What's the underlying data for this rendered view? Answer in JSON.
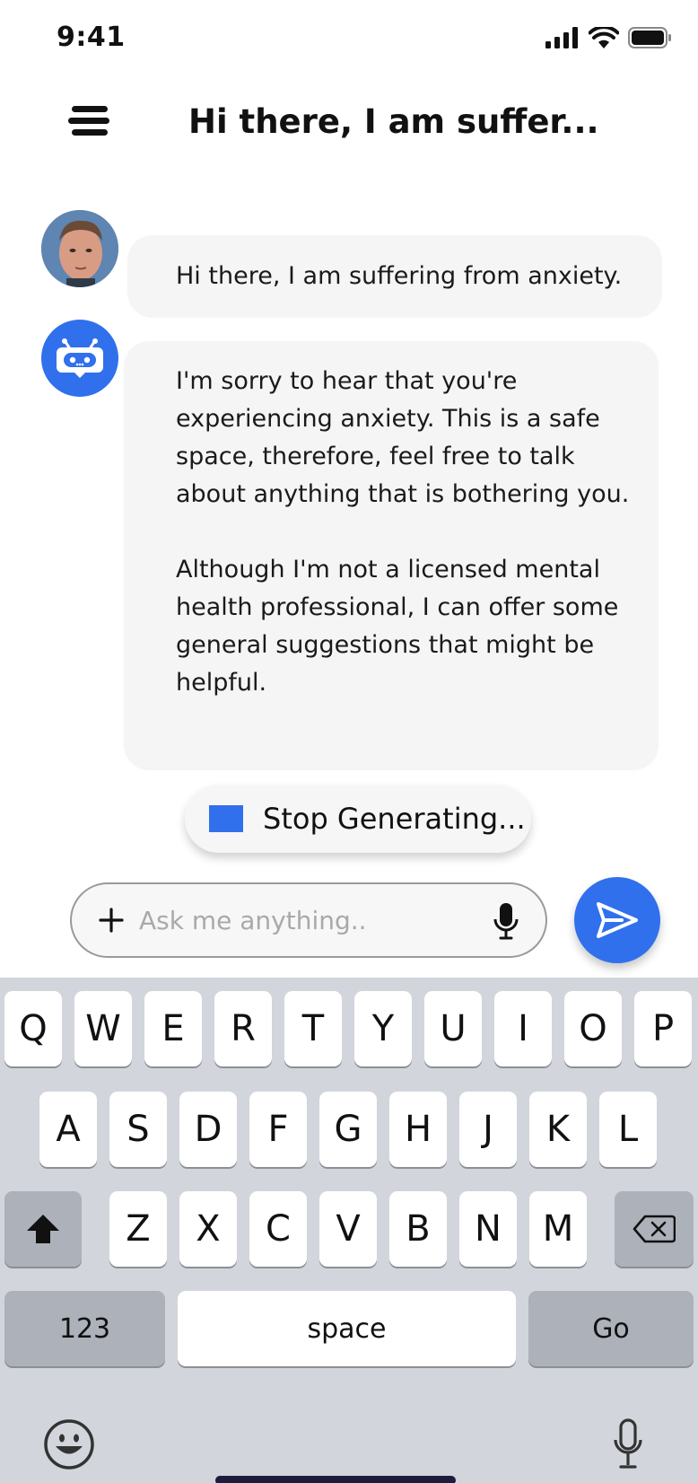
{
  "status_bar": {
    "time": "9:41"
  },
  "header": {
    "title": "Hi there, I am suffer..."
  },
  "messages": {
    "user": {
      "text": "Hi there, I am suffering from anxiety."
    },
    "bot": {
      "paragraph_1": "I'm sorry to hear that you're experiencing anxiety. This is a safe space, therefore, feel free to talk about anything that is bothering you.",
      "paragraph_2": "Although I'm not a licensed mental health professional, I can offer some general suggestions that might be helpful."
    }
  },
  "stop_button": {
    "label": "Stop Generating..."
  },
  "input": {
    "placeholder": "Ask me anything..",
    "value": ""
  },
  "keyboard": {
    "row1": [
      "Q",
      "W",
      "E",
      "R",
      "T",
      "Y",
      "U",
      "I",
      "O",
      "P"
    ],
    "row2": [
      "A",
      "S",
      "D",
      "F",
      "G",
      "H",
      "J",
      "K",
      "L"
    ],
    "row3": [
      "Z",
      "X",
      "C",
      "V",
      "B",
      "N",
      "M"
    ],
    "numbers_label": "123",
    "space_label": "space",
    "go_label": "Go"
  },
  "colors": {
    "accent": "#3170ec",
    "bubble": "#f5f5f5",
    "keyboard_bg": "#d2d5db"
  },
  "icons": [
    "menu-icon",
    "robot-icon",
    "stop-icon",
    "plus-icon",
    "microphone-icon",
    "send-icon",
    "shift-icon",
    "backspace-icon",
    "emoji-icon",
    "dictation-icon"
  ]
}
